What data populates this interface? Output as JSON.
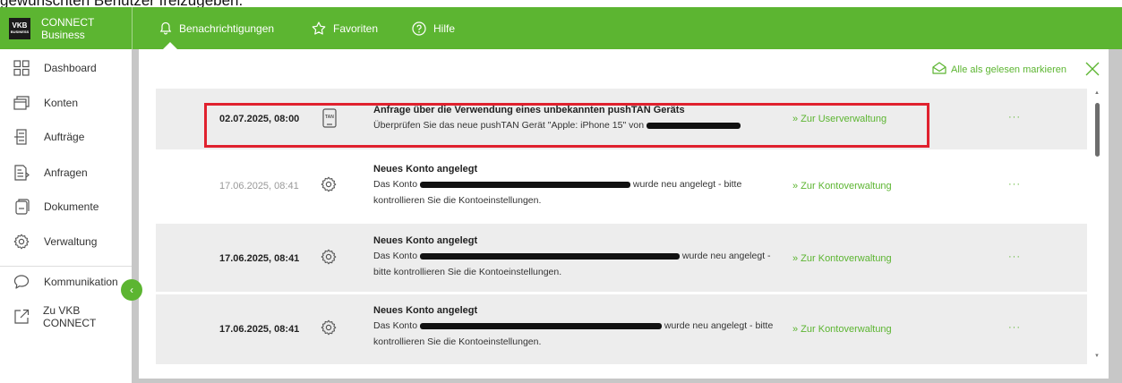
{
  "caption": "gewünschten Benutzer freizugeben.",
  "header": {
    "brand_line1": "CONNECT",
    "brand_line2": "Business",
    "logo_text": "VKB",
    "logo_sub": "BUSINESS",
    "tabs": [
      {
        "label": "Benachrichtigungen",
        "icon": "bell-icon"
      },
      {
        "label": "Favoriten",
        "icon": "star-icon"
      },
      {
        "label": "Hilfe",
        "icon": "help-icon"
      }
    ]
  },
  "sidebar": {
    "items": [
      {
        "label": "Dashboard",
        "icon": "dashboard-icon"
      },
      {
        "label": "Konten",
        "icon": "accounts-icon"
      },
      {
        "label": "Aufträge",
        "icon": "orders-icon"
      },
      {
        "label": "Anfragen",
        "icon": "requests-icon"
      },
      {
        "label": "Dokumente",
        "icon": "documents-icon"
      },
      {
        "label": "Verwaltung",
        "icon": "gear-icon"
      },
      {
        "label": "Kommunikation",
        "icon": "chat-icon"
      },
      {
        "label": "Zu VKB CONNECT",
        "icon": "external-link-icon"
      }
    ],
    "collapse_glyph": "‹"
  },
  "toolbar": {
    "mark_all_label": "Alle als gelesen markieren"
  },
  "notifications": [
    {
      "date": "02.07.2025, 08:00",
      "icon": "pushtan-device-icon",
      "icon_text": "TAN",
      "title": "Anfrage über die Verwendung eines unbekannten pushTAN Geräts",
      "body_pre": "Überprüfen Sie das neue pushTAN Gerät \"Apple: iPhone 15\" von",
      "body_post": "",
      "link": "» Zur Userverwaltung",
      "more": "···",
      "unread": true
    },
    {
      "date": "17.06.2025, 08:41",
      "icon": "gear-icon",
      "title": "Neues Konto angelegt",
      "body_pre": "Das Konto",
      "body_post": "wurde neu angelegt - bitte kontrollieren Sie die Kontoeinstellungen.",
      "link": "» Zur Kontoverwaltung",
      "more": "···",
      "unread": false
    },
    {
      "date": "17.06.2025, 08:41",
      "icon": "gear-icon",
      "title": "Neues Konto angelegt",
      "body_pre": "Das Konto",
      "body_post": "wurde neu angelegt - bitte kontrollieren Sie die Kontoeinstellungen.",
      "link": "» Zur Kontoverwaltung",
      "more": "···",
      "unread": true
    },
    {
      "date": "17.06.2025, 08:41",
      "icon": "gear-icon",
      "title": "Neues Konto angelegt",
      "body_pre": "Das Konto",
      "body_post": "wurde neu angelegt - bitte kontrollieren Sie die Kontoeinstellungen.",
      "link": "» Zur Kontoverwaltung",
      "more": "···",
      "unread": true
    }
  ],
  "colors": {
    "brand_green": "#5cb531",
    "highlight_red": "#e0212e",
    "row_gray": "#ededed"
  }
}
